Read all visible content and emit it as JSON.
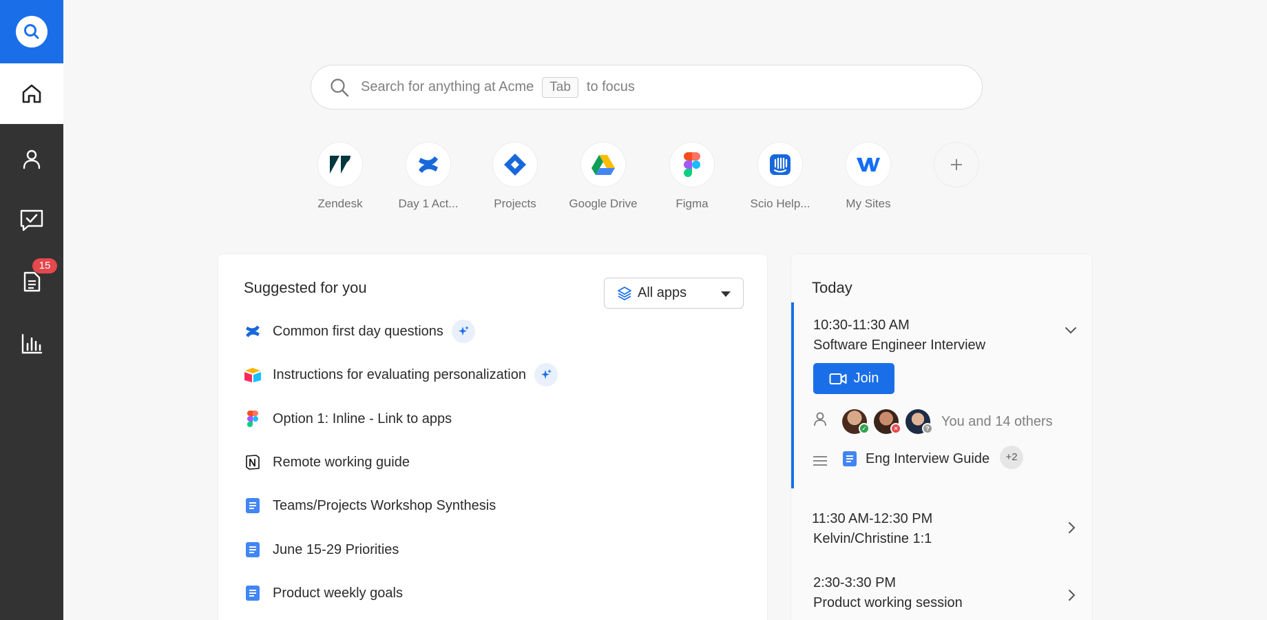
{
  "sidebar": {
    "badge_count": "15",
    "items": [
      {
        "name": "home"
      },
      {
        "name": "people"
      },
      {
        "name": "tasks"
      },
      {
        "name": "documents"
      },
      {
        "name": "analytics"
      }
    ]
  },
  "search": {
    "placeholder_prefix": "Search for anything at Acme",
    "key_hint": "Tab",
    "placeholder_suffix": "to focus"
  },
  "apps": [
    {
      "label": "Zendesk",
      "icon": "zendesk-icon"
    },
    {
      "label": "Day 1 Act...",
      "icon": "confluence-icon"
    },
    {
      "label": "Projects",
      "icon": "jira-icon"
    },
    {
      "label": "Google Drive",
      "icon": "google-drive-icon"
    },
    {
      "label": "Figma",
      "icon": "figma-icon"
    },
    {
      "label": "Scio Help...",
      "icon": "intercom-icon"
    },
    {
      "label": "My Sites",
      "icon": "webflow-icon"
    }
  ],
  "suggested": {
    "title": "Suggested for you",
    "filter_label": "All apps",
    "items": [
      {
        "label": "Common first day questions",
        "icon": "confluence-icon",
        "ai": true
      },
      {
        "label": "Instructions for evaluating personalization",
        "icon": "airtable-icon",
        "ai": true
      },
      {
        "label": "Option 1: Inline - Link to apps",
        "icon": "figma-icon",
        "ai": false
      },
      {
        "label": "Remote working guide",
        "icon": "notion-icon",
        "ai": false
      },
      {
        "label": "Teams/Projects Workshop Synthesis",
        "icon": "google-docs-icon",
        "ai": false
      },
      {
        "label": "June 15-29 Priorities",
        "icon": "google-docs-icon",
        "ai": false
      },
      {
        "label": "Product weekly goals",
        "icon": "google-docs-icon",
        "ai": false
      }
    ]
  },
  "today": {
    "title": "Today",
    "events": [
      {
        "time": "10:30-11:30 AM",
        "title": "Software Engineer Interview",
        "join_label": "Join",
        "attendees_text": "You and 14 others",
        "doc_label": "Eng Interview Guide",
        "doc_extra": "+2"
      },
      {
        "time": "11:30 AM-12:30 PM",
        "title": "Kelvin/Christine 1:1"
      },
      {
        "time": "2:30-3:30 PM",
        "title": "Product working session"
      }
    ]
  },
  "colors": {
    "accent": "#1a6fe8",
    "sidebar": "#333333",
    "badge": "#e5484d"
  }
}
